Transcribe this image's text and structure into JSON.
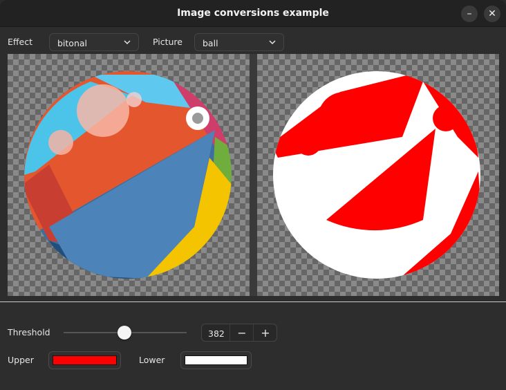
{
  "window": {
    "title": "Image conversions example"
  },
  "controls": {
    "effect_label": "Effect",
    "effect_value": "bitonal",
    "picture_label": "Picture",
    "picture_value": "ball"
  },
  "threshold": {
    "label": "Threshold",
    "value": "382",
    "slider_fraction": 0.5
  },
  "colors": {
    "upper_label": "Upper",
    "upper_color": "#ff0000",
    "lower_label": "Lower",
    "lower_color": "#ffffff"
  },
  "icons": {
    "minimize": "minimize-icon",
    "close": "close-icon",
    "dropdown": "chevron-down-icon",
    "decrement": "minus-icon",
    "increment": "plus-icon"
  }
}
